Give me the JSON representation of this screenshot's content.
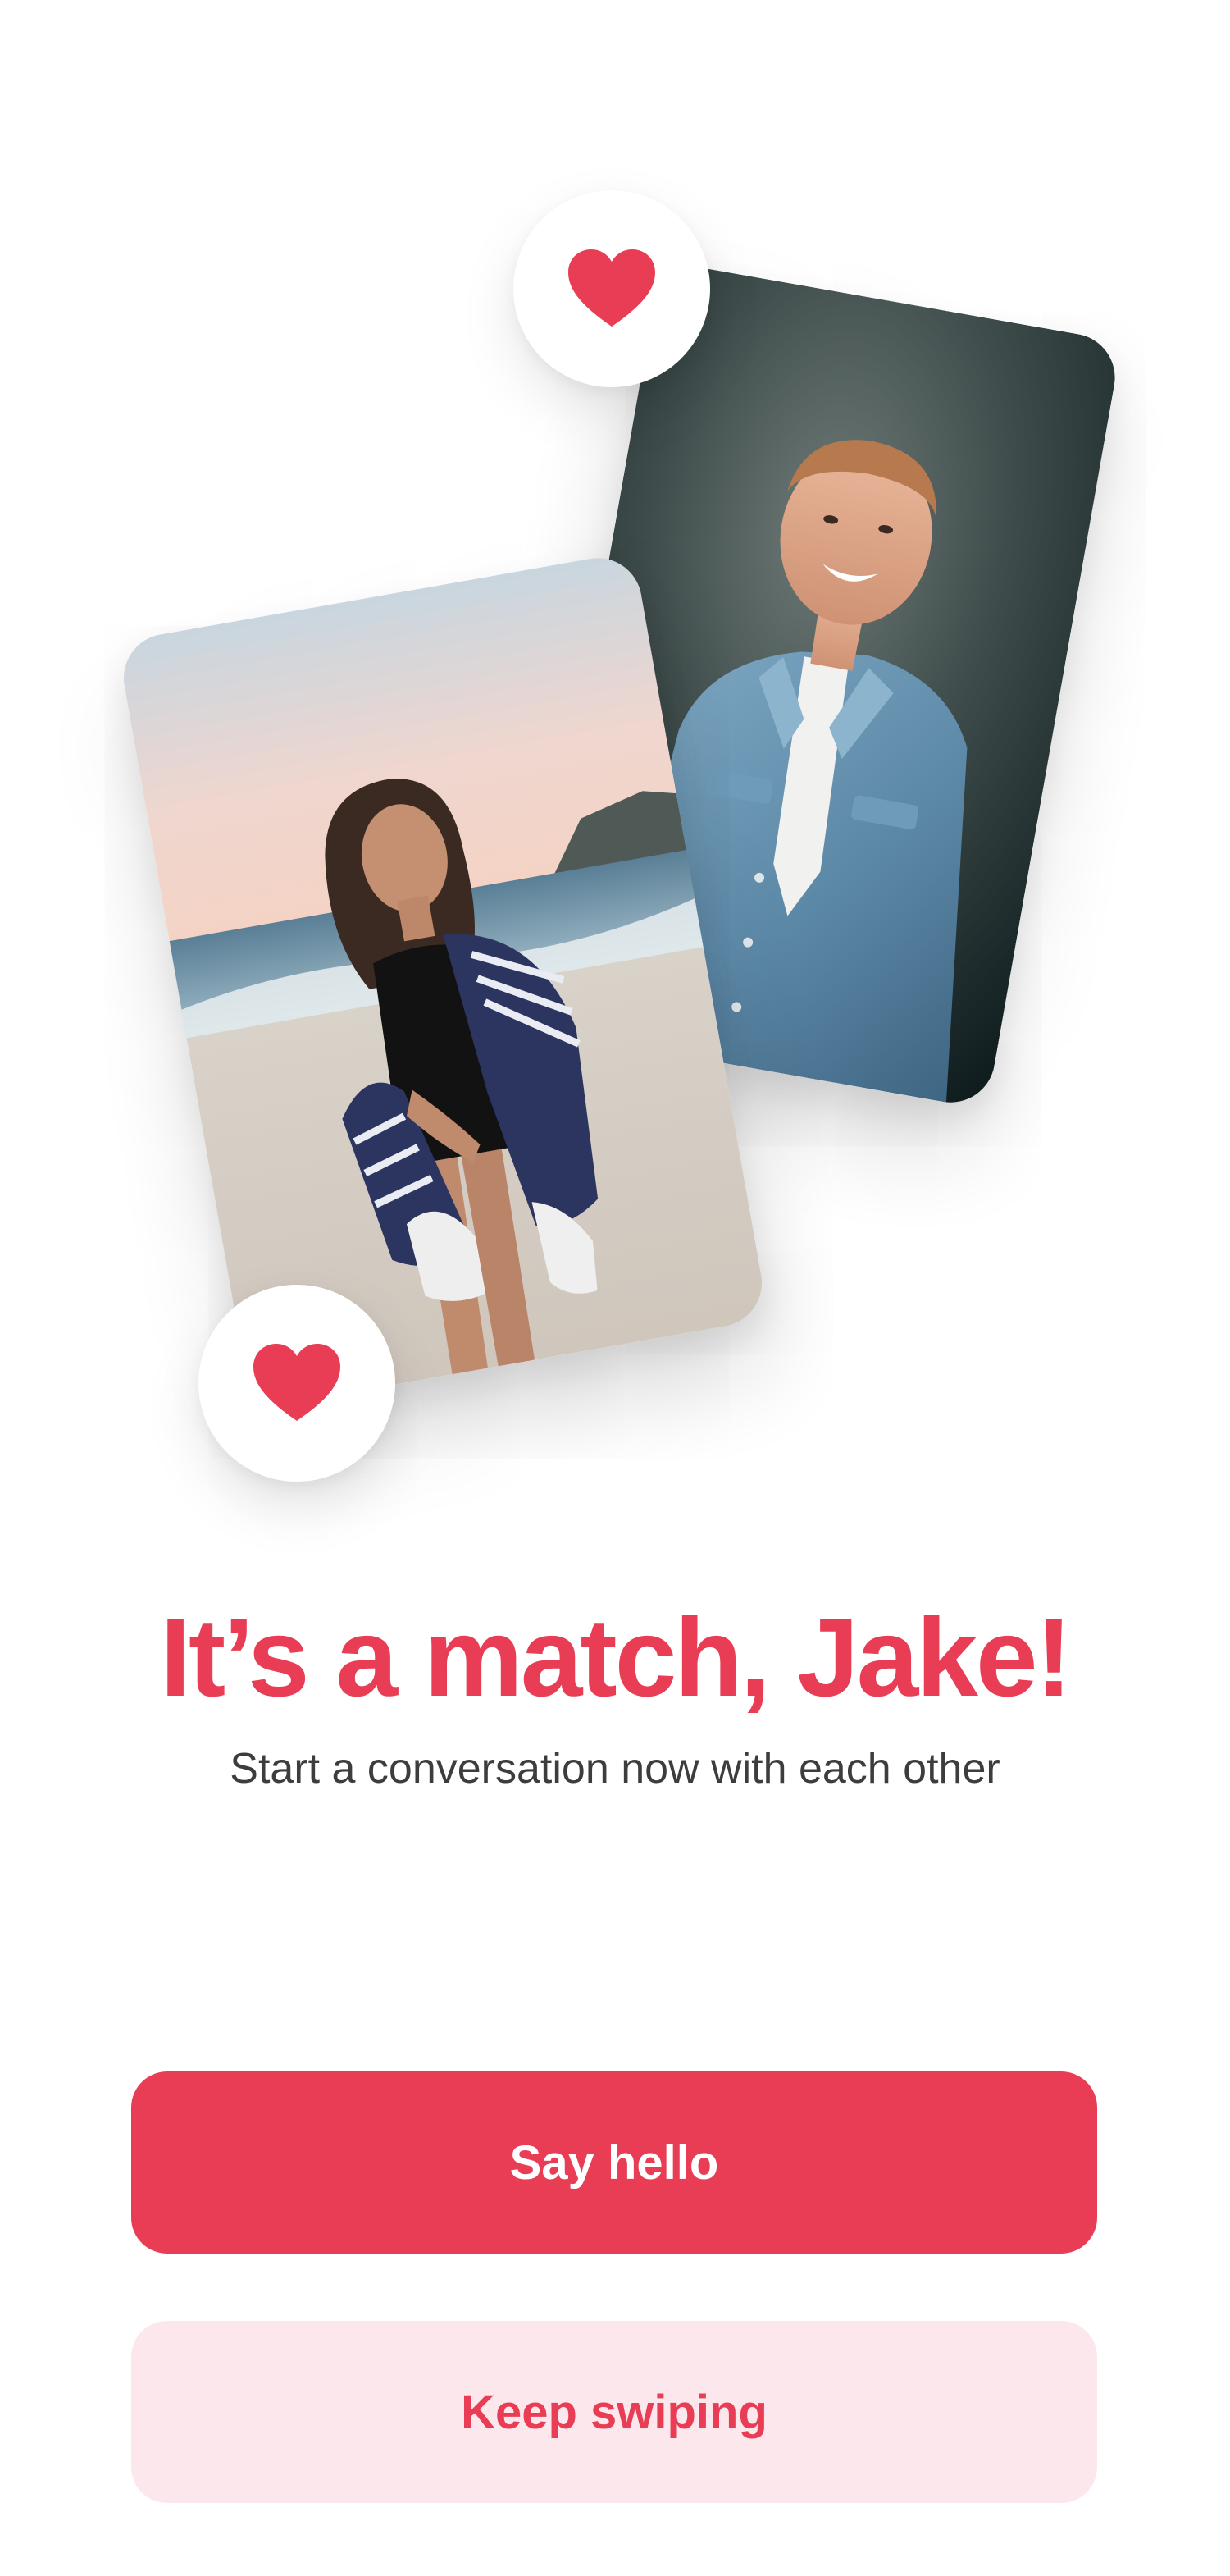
{
  "colors": {
    "accent": "#e83d55",
    "accent_soft": "#fce8ec",
    "subtitle_text": "#3d3d3d",
    "background": "#ffffff"
  },
  "photos": {
    "back": {
      "subject": "smiling man in denim jacket against dark teal wall"
    },
    "front": {
      "subject": "woman on beach holding navy striped towel"
    }
  },
  "badges": {
    "top_icon": "heart-icon",
    "bottom_icon": "heart-icon"
  },
  "match": {
    "title": "It’s a match, Jake!",
    "subtitle": "Start a conversation now with each other"
  },
  "actions": {
    "primary_label": "Say hello",
    "secondary_label": "Keep swiping"
  }
}
